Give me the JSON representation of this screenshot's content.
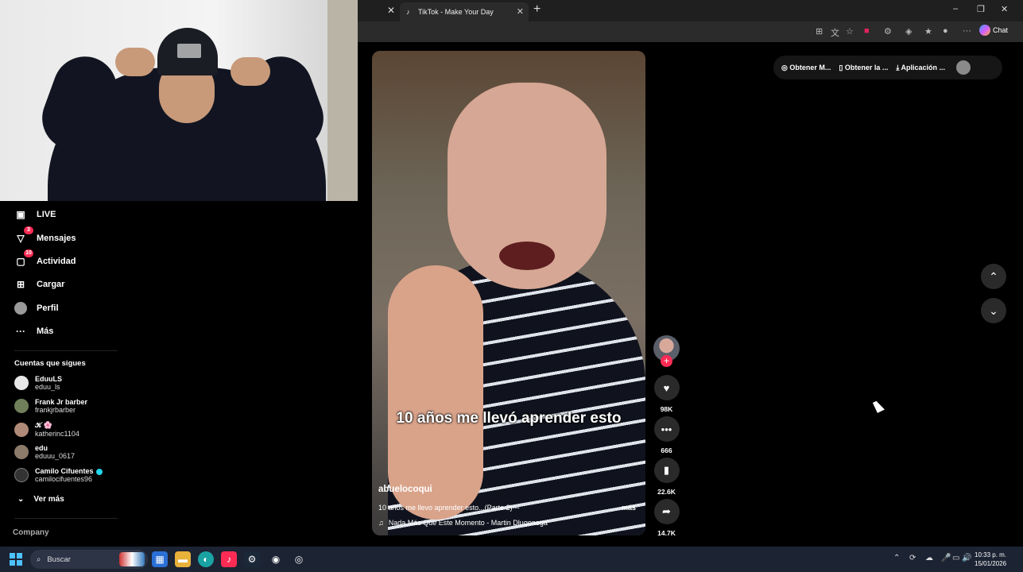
{
  "browser": {
    "tab_title": "TikTok - Make Your Day",
    "tab_icon": "tiktok-icon",
    "close_symbol": "✕",
    "new_tab_symbol": "+",
    "window_controls": [
      "–",
      "❐",
      "✕"
    ],
    "chat_label": "Chat"
  },
  "sidebar": {
    "items": [
      {
        "label": "LIVE",
        "icon": "live-icon",
        "glyph": "▣"
      },
      {
        "label": "Mensajes",
        "icon": "messages-icon",
        "glyph": "▽",
        "badge": "3"
      },
      {
        "label": "Actividad",
        "icon": "activity-icon",
        "glyph": "▢",
        "badge": "10"
      },
      {
        "label": "Cargar",
        "icon": "upload-icon",
        "glyph": "⊞"
      },
      {
        "label": "Perfil",
        "icon": "profile-avatar",
        "glyph": ""
      },
      {
        "label": "Más",
        "icon": "more-icon",
        "glyph": "···"
      }
    ],
    "following_title": "Cuentas que sigues",
    "following": [
      {
        "display": "EduuLS",
        "user": "eduu_ls"
      },
      {
        "display": "Frank Jr barber",
        "user": "frankjrbarber"
      },
      {
        "display": "𝒦 🌸",
        "user": "katherinc1104"
      },
      {
        "display": "edu",
        "user": "eduuu_0617"
      },
      {
        "display": "Camilo Cifuentes",
        "user": "camilocifuentes96",
        "verified": true
      }
    ],
    "see_more": "Ver más",
    "see_more_glyph": "⌄",
    "company": "Company"
  },
  "video": {
    "caption": "10 años me llevó aprender esto",
    "author": "abuelocoqui",
    "description": "10 años me llevo aprender esto...(Parte 2)---",
    "more": "más",
    "music_glyph": "♫",
    "music": "Nada Más Que Este Momento - Martin Dlugonoga"
  },
  "actions": {
    "follow_plus": "+",
    "like": {
      "glyph": "♥",
      "count": "98K"
    },
    "comment": {
      "glyph": "•••",
      "count": "666"
    },
    "save": {
      "glyph": "▮",
      "count": "22.6K"
    },
    "share": {
      "glyph": "➦",
      "count": "14.7K"
    }
  },
  "topbar": {
    "items": [
      "Obtener M...",
      "Obtener la ...",
      "Aplicación ..."
    ],
    "icons": [
      "◎",
      "▯",
      "⤓"
    ]
  },
  "nav": {
    "up": "⌃",
    "down": "⌄"
  },
  "taskbar": {
    "search_placeholder": "Buscar",
    "search_icon": "⌕",
    "time": "10:33 p. m.",
    "date": "15/01/2026",
    "tray_glyphs": [
      "⌃",
      "⟳",
      "☁",
      "🎤",
      "▭",
      "🔊"
    ]
  }
}
